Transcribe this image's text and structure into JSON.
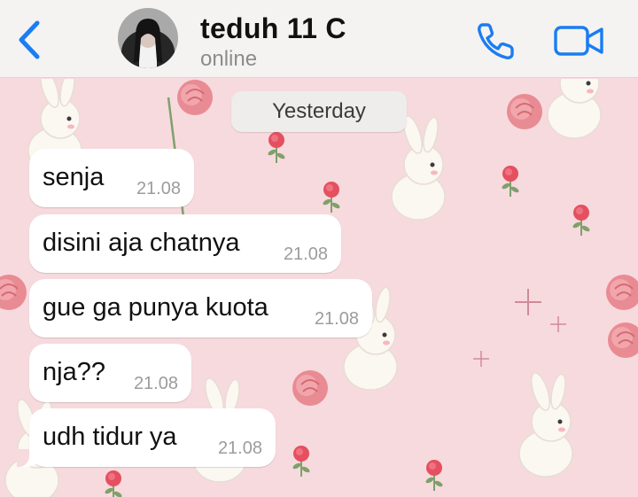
{
  "header": {
    "contact_name": "teduh 11 C",
    "status": "online",
    "icons": [
      "chevron-left-icon",
      "phone-icon",
      "video-camera-icon"
    ],
    "accent_color": "#1a7df2"
  },
  "chat": {
    "date_separator": "Yesterday",
    "messages": [
      {
        "text": "senja",
        "time": "21.08"
      },
      {
        "text": "disini aja chatnya",
        "time": "21.08"
      },
      {
        "text": "gue ga punya kuota",
        "time": "21.08"
      },
      {
        "text": "nja??",
        "time": "21.08"
      },
      {
        "text": "udh tidur ya",
        "time": "21.08"
      }
    ]
  },
  "colors": {
    "wallpaper": "#f6dade",
    "bubble": "#ffffff",
    "header": "#f4f3f2"
  }
}
